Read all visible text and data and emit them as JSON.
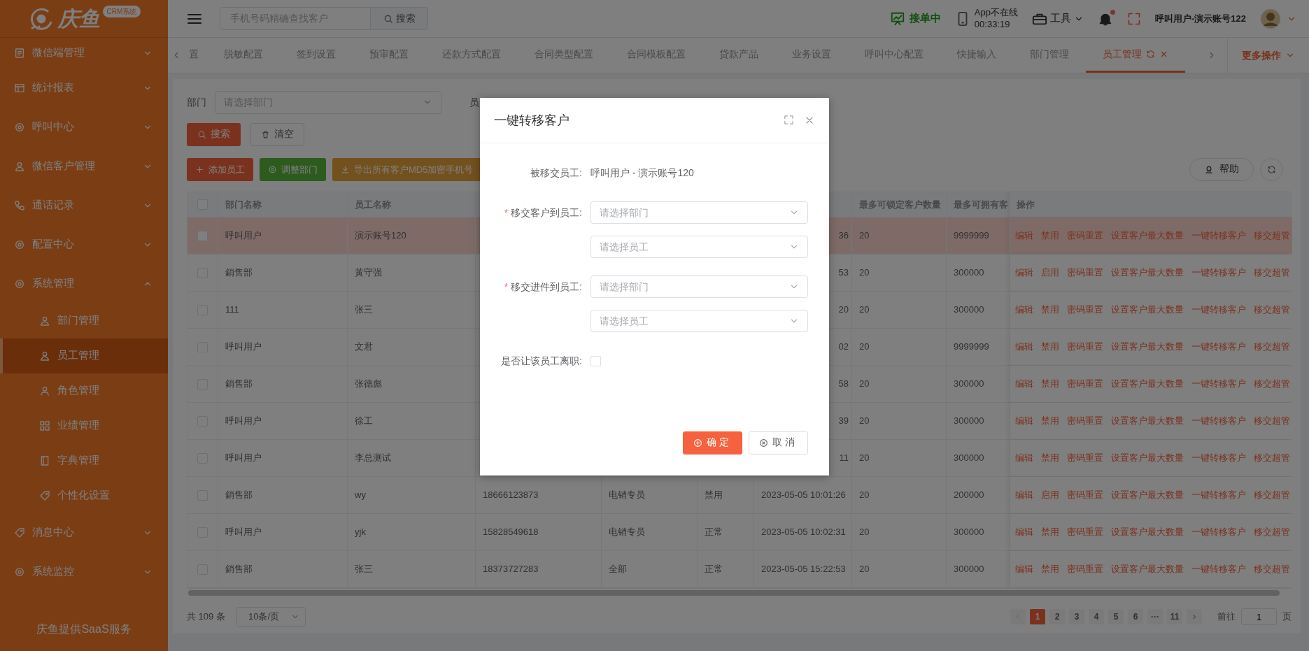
{
  "sidebar": {
    "logo": {
      "text": "庆鱼",
      "badge": "CRM系统"
    },
    "items": [
      {
        "label": "微信端管理",
        "expanded": false
      },
      {
        "label": "统计报表",
        "expanded": false
      },
      {
        "label": "呼叫中心",
        "expanded": false
      },
      {
        "label": "微信客户管理",
        "expanded": false
      },
      {
        "label": "通话记录",
        "expanded": false
      },
      {
        "label": "配置中心",
        "expanded": false
      },
      {
        "label": "系统管理",
        "expanded": true,
        "children": [
          {
            "label": "部门管理",
            "selected": false
          },
          {
            "label": "员工管理",
            "selected": true
          },
          {
            "label": "角色管理",
            "selected": false
          },
          {
            "label": "业绩管理",
            "selected": false
          },
          {
            "label": "字典管理",
            "selected": false
          },
          {
            "label": "个性化设置",
            "selected": false
          }
        ]
      },
      {
        "label": "消息中心",
        "expanded": false
      },
      {
        "label": "系统监控",
        "expanded": false
      }
    ],
    "footer": "庆鱼提供SaaS服务"
  },
  "header": {
    "search_placeholder": "手机号码精确查找客户",
    "search_button": "搜索",
    "order_status": "接单中",
    "app_status": "App不在线",
    "timer": "00:33:19",
    "tools": "工具",
    "notification": {
      "unread": true
    },
    "user": "呼叫用户-演示账号122"
  },
  "tabs": {
    "items": [
      {
        "label": "置",
        "selected": false
      },
      {
        "label": "脱敏配置",
        "selected": false
      },
      {
        "label": "签到设置",
        "selected": false
      },
      {
        "label": "预审配置",
        "selected": false
      },
      {
        "label": "还款方式配置",
        "selected": false
      },
      {
        "label": "合同类型配置",
        "selected": false
      },
      {
        "label": "合同模板配置",
        "selected": false
      },
      {
        "label": "贷款产品",
        "selected": false
      },
      {
        "label": "业务设置",
        "selected": false
      },
      {
        "label": "呼叫中心配置",
        "selected": false
      },
      {
        "label": "快捷输入",
        "selected": false
      },
      {
        "label": "部门管理",
        "selected": false
      },
      {
        "label": "员工管理",
        "selected": true
      }
    ],
    "more": "更多操作"
  },
  "filter": {
    "fields": [
      {
        "label": "部门",
        "placeholder": "请选择部门"
      },
      {
        "label": "员"
      }
    ],
    "search_button": "搜索",
    "clear_button": "清空"
  },
  "toolbar": {
    "buttons": [
      {
        "label": "添加员工",
        "kind": "add"
      },
      {
        "label": "调整部门",
        "kind": "adjust"
      },
      {
        "label": "导出所有客户MD5加密手机号",
        "kind": "export"
      }
    ],
    "help": "帮助"
  },
  "table": {
    "select_all_checked": false,
    "columns": [
      "部门名称",
      "员工名称",
      "最多可锁定客户数量",
      "最多可拥有客",
      "操作"
    ],
    "rows": [
      {
        "dept": "呼叫用户",
        "name": "演示账号120",
        "time": "36",
        "lock": "20",
        "max": "9999999",
        "checked": false,
        "selected": true,
        "actions": [
          "编辑",
          "禁用",
          "密码重置",
          "设置客户最大数量",
          "一键转移客户",
          "移交超管"
        ]
      },
      {
        "dept": "銷售部",
        "name": "黃守强",
        "time": "53",
        "lock": "20",
        "max": "300000",
        "checked": false,
        "selected": false,
        "actions": [
          "编辑",
          "启用",
          "密码重置",
          "设置客户最大数量",
          "一键转移客户",
          "移交超管"
        ]
      },
      {
        "dept": "111",
        "name": "张三",
        "time": "20",
        "lock": "20",
        "max": "300000",
        "checked": false,
        "selected": false,
        "actions": [
          "编辑",
          "禁用",
          "密码重置",
          "设置客户最大数量",
          "一键转移客户",
          "移交超管"
        ]
      },
      {
        "dept": "呼叫用户",
        "name": "文君",
        "time": "02",
        "lock": "20",
        "max": "9999999",
        "checked": false,
        "selected": false,
        "actions": [
          "编辑",
          "禁用",
          "密码重置",
          "设置客户最大数量",
          "一键转移客户",
          "移交超管"
        ]
      },
      {
        "dept": "銷售部",
        "name": "张德彪",
        "time": "58",
        "lock": "20",
        "max": "300000",
        "checked": false,
        "selected": false,
        "actions": [
          "编辑",
          "禁用",
          "密码重置",
          "设置客户最大数量",
          "一键转移客户",
          "移交超管"
        ]
      },
      {
        "dept": "呼叫用户",
        "name": "徐工",
        "time": "39",
        "lock": "20",
        "max": "300000",
        "checked": false,
        "selected": false,
        "actions": [
          "编辑",
          "禁用",
          "密码重置",
          "设置客户最大数量",
          "一键转移客户",
          "移交超管"
        ]
      },
      {
        "dept": "呼叫用户",
        "name": "李总测试",
        "time": "11",
        "lock": "20",
        "max": "300000",
        "checked": false,
        "selected": false,
        "actions": [
          "编辑",
          "禁用",
          "密码重置",
          "设置客户最大数量",
          "一键转移客户",
          "移交超管"
        ]
      },
      {
        "dept": "銷售部",
        "name": "wy",
        "phone": "18666123873",
        "role": "电销专员",
        "status": "禁用",
        "time": "2023-05-05 10:01:26",
        "lock": "20",
        "max": "200000",
        "checked": false,
        "selected": false,
        "actions": [
          "编辑",
          "启用",
          "密码重置",
          "设置客户最大数量",
          "一键转移客户",
          "移交超管"
        ]
      },
      {
        "dept": "呼叫用户",
        "name": "yjk",
        "phone": "15828549618",
        "role": "电销专员",
        "status": "正常",
        "time": "2023-05-05 10:02:31",
        "lock": "20",
        "max": "300000",
        "checked": false,
        "selected": false,
        "actions": [
          "编辑",
          "禁用",
          "密码重置",
          "设置客户最大数量",
          "一键转移客户",
          "移交超管"
        ]
      },
      {
        "dept": "銷售部",
        "name": "张三",
        "phone": "18373727283",
        "role": "全部",
        "status": "正常",
        "time": "2023-05-05 15:22:53",
        "lock": "20",
        "max": "300000",
        "checked": false,
        "selected": false,
        "actions": [
          "编辑",
          "禁用",
          "密码重置",
          "设置客户最大数量",
          "一键转移客户",
          "移交超管"
        ]
      }
    ]
  },
  "pagination": {
    "total": "共 109 条",
    "page_size": "10条/页",
    "pages": [
      {
        "label": "1",
        "selected": true
      },
      {
        "label": "2",
        "selected": false
      },
      {
        "label": "3",
        "selected": false
      },
      {
        "label": "4",
        "selected": false
      },
      {
        "label": "5",
        "selected": false
      },
      {
        "label": "6",
        "selected": false
      },
      {
        "label": "···",
        "selected": false
      },
      {
        "label": "11",
        "selected": false
      }
    ],
    "goto_label": "前往",
    "goto_value": "1",
    "goto_suffix": "页"
  },
  "modal": {
    "title": "一键转移客户",
    "rows": [
      {
        "kind": "text",
        "label": "被移交员工:",
        "value": "呼叫用户 - 演示账号120"
      },
      {
        "kind": "select",
        "label": "移交客户到员工:",
        "required_mark": "*",
        "placeholders": [
          "请选择部门",
          "请选择员工"
        ]
      },
      {
        "kind": "select",
        "label": "移交进件到员工:",
        "required_mark": "*",
        "placeholders": [
          "请选择部门",
          "请选择员工"
        ]
      },
      {
        "kind": "checkbox",
        "label": "是否让该员工离职:",
        "checked": false
      }
    ],
    "buttons": [
      {
        "label": "确定",
        "kind": "primary"
      },
      {
        "label": "取消",
        "kind": "default"
      }
    ]
  }
}
